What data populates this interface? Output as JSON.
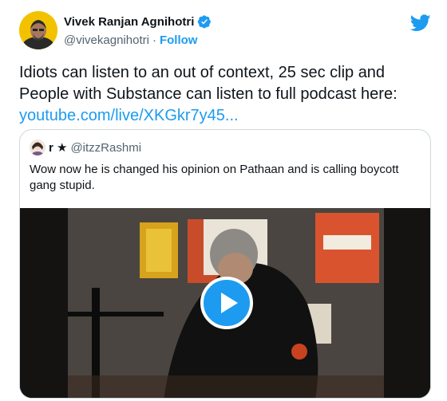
{
  "author": {
    "display_name": "Vivek Ranjan Agnihotri",
    "handle": "@vivekagnihotri",
    "separator": "·",
    "follow_label": "Follow",
    "verified_icon": "verified-badge-icon"
  },
  "tweet": {
    "text": "Idiots can listen to an out of context, 25 sec clip and People with Substance can listen to full podcast here:",
    "link_text": "youtube.com/live/XKGkr7y45..."
  },
  "quoted": {
    "display_name": "r ★",
    "handle": "@itzzRashmi",
    "text": "Wow now he is changed his opinion on Pathaan and is calling boycott gang stupid."
  },
  "colors": {
    "accent": "#1d9bf0",
    "text": "#0f1419",
    "muted": "#536471",
    "border": "#cfd9de"
  }
}
